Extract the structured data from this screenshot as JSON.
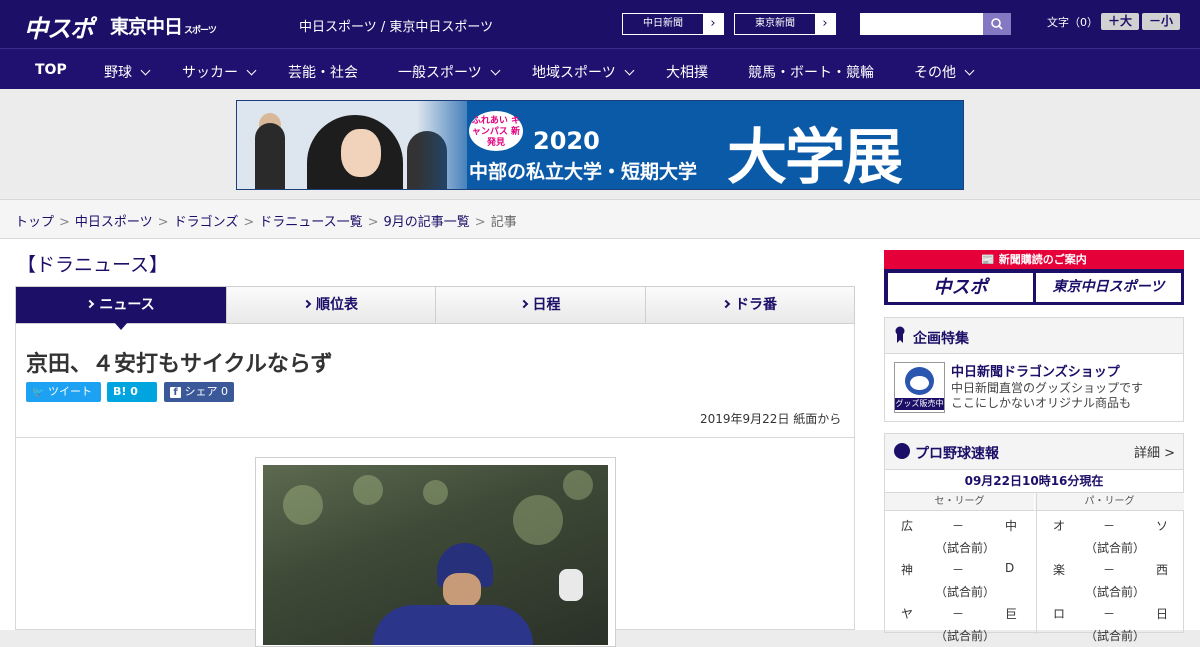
{
  "header": {
    "logo_main": "中スポ",
    "logo_sub": "東京中日",
    "logo_sub_small": "スポーツ",
    "site_name": "中日スポーツ / 東京中日スポーツ",
    "paper_links": [
      "中日新聞",
      "東京新聞"
    ],
    "font_size_label": "文字（0）",
    "font_larger": "＋大",
    "font_smaller": "－小"
  },
  "nav": [
    "TOP",
    "野球",
    "サッカー",
    "芸能・社会",
    "一般スポーツ",
    "地域スポーツ",
    "大相撲",
    "競馬・ボート・競輪",
    "その他"
  ],
  "banner": {
    "badge": "ふれあい キャンパス 新発見",
    "year": "2020",
    "subtitle": "中部の私立大学・短期大学",
    "headline": "大学展"
  },
  "breadcrumb": {
    "items": [
      "トップ",
      "中日スポーツ",
      "ドラゴンズ",
      "ドラニュース一覧",
      "9月の記事一覧"
    ],
    "current": "記事",
    "separator": ">"
  },
  "section_title": "【ドラニュース】",
  "tabs": [
    "ニュース",
    "順位表",
    "日程",
    "ドラ番"
  ],
  "article": {
    "title": "京田、４安打もサイクルならず",
    "share": {
      "tweet": "ツイート",
      "hatena": "B! 0",
      "facebook": "シェア 0"
    },
    "date": "2019年9月22日 紙面から"
  },
  "sidebar": {
    "ad_title": "新聞購読のご案内",
    "ad_logo_1": "中スポ",
    "ad_logo_2": "東京中日スポーツ",
    "feature_title": "企画特集",
    "shop_name": "中日新聞ドラゴンズショップ",
    "shop_desc_1": "中日新聞直営のグッズショップです",
    "shop_desc_2": "ここにしかないオリジナル商品も",
    "shop_img_text": "グッズ販売中",
    "score_title": "プロ野球速報",
    "score_more": "詳細 >",
    "timestamp": "09月22日10時16分現在",
    "central": "セ・リーグ",
    "pacific": "パ・リーグ",
    "central_games": [
      {
        "home": "広",
        "score": "－",
        "away": "中",
        "status": "（試合前）"
      },
      {
        "home": "神",
        "score": "－",
        "away": "D",
        "status": "（試合前）"
      },
      {
        "home": "ヤ",
        "score": "－",
        "away": "巨",
        "status": "（試合前）"
      }
    ],
    "pacific_games": [
      {
        "home": "オ",
        "score": "－",
        "away": "ソ",
        "status": "（試合前）"
      },
      {
        "home": "楽",
        "score": "－",
        "away": "西",
        "status": "（試合前）"
      },
      {
        "home": "ロ",
        "score": "－",
        "away": "日",
        "status": "（試合前）"
      }
    ]
  }
}
